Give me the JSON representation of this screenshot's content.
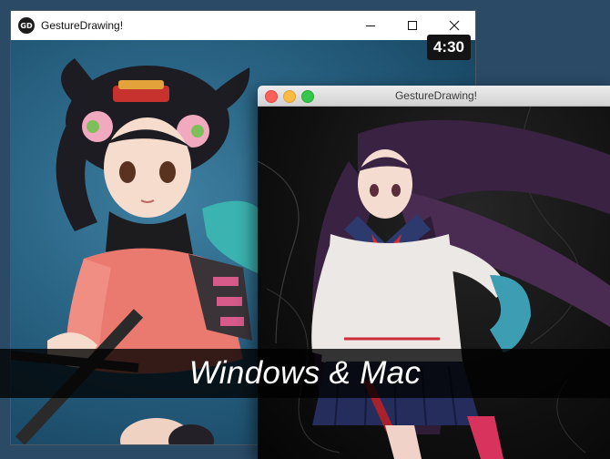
{
  "windows_window": {
    "icon_text": "GD",
    "title": "GestureDrawing!",
    "timer": "4:30",
    "controls": [
      "minimize",
      "maximize",
      "close"
    ]
  },
  "mac_window": {
    "title": "GestureDrawing!",
    "traffic_lights": {
      "close": "#fc605b",
      "minimize": "#fdbc40",
      "zoom": "#34c84a"
    }
  },
  "caption": {
    "text": "Windows & Mac"
  }
}
